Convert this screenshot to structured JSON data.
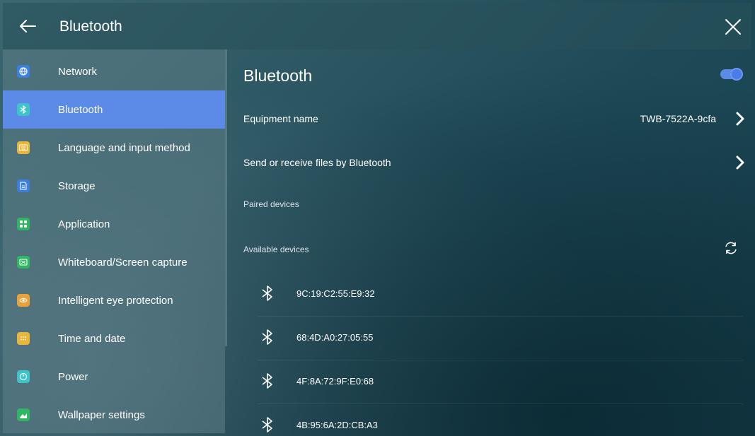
{
  "header": {
    "title": "Bluetooth",
    "back_icon": "back-arrow-icon",
    "close_icon": "close-icon"
  },
  "sidebar": {
    "items": [
      {
        "label": "Network",
        "icon": "globe-icon",
        "color": "#3b7fe0"
      },
      {
        "label": "Bluetooth",
        "icon": "bluetooth-icon",
        "color": "#3ec4c8",
        "active": true
      },
      {
        "label": "Language and input method",
        "icon": "keyboard-icon",
        "color": "#e8b63a"
      },
      {
        "label": "Storage",
        "icon": "storage-icon",
        "color": "#3b7fe0"
      },
      {
        "label": "Application",
        "icon": "apps-icon",
        "color": "#2fb564"
      },
      {
        "label": "Whiteboard/Screen capture",
        "icon": "screen-capture-icon",
        "color": "#2fb564"
      },
      {
        "label": "Intelligent eye protection",
        "icon": "eye-icon",
        "color": "#e8a23a"
      },
      {
        "label": "Time and date",
        "icon": "calendar-icon",
        "color": "#e8b63a"
      },
      {
        "label": "Power",
        "icon": "power-icon",
        "color": "#3ec4c8"
      },
      {
        "label": "Wallpaper settings",
        "icon": "wallpaper-icon",
        "color": "#2fb564"
      }
    ]
  },
  "main": {
    "title": "Bluetooth",
    "toggle_on": true,
    "equipment_name_label": "Equipment name",
    "equipment_name_value": "TWB-7522A-9cfa",
    "send_receive_label": "Send or receive files by Bluetooth",
    "paired_label": "Paired devices",
    "available_label": "Available devices",
    "devices": [
      "9C:19:C2:55:E9:32",
      "68:4D:A0:27:05:55",
      "4F:8A:72:9F:E0:68",
      "4B:95:6A:2D:CB:A3"
    ]
  },
  "colors": {
    "accent": "#5b8be6"
  }
}
